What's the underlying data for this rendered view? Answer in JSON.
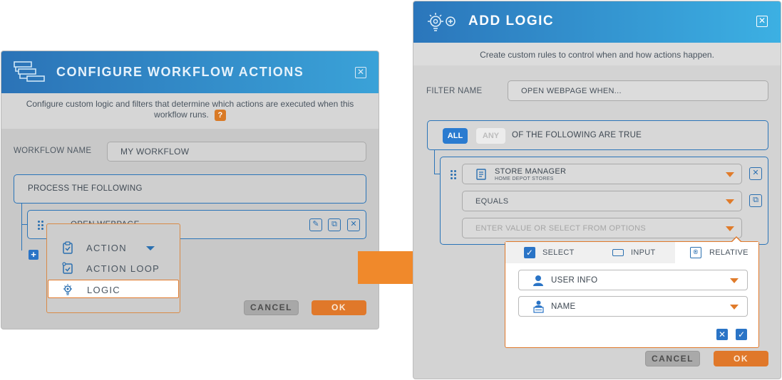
{
  "left_dialog": {
    "title": "CONFIGURE WORKFLOW ACTIONS",
    "description": "Configure custom logic and filters that determine which actions are executed when this workflow runs.",
    "help_badge": "?",
    "workflow_name_label": "WORKFLOW NAME",
    "workflow_name_value": "MY WORKFLOW",
    "process_label": "PROCESS THE FOLLOWING",
    "action_item_label": "OPEN WEBPAGE",
    "menu": {
      "items": [
        {
          "label": "ACTION",
          "icon": "clipboard-check-icon"
        },
        {
          "label": "ACTION LOOP",
          "icon": "loop-icon"
        },
        {
          "label": "LOGIC",
          "icon": "logic-bulb-icon"
        }
      ]
    },
    "cancel_label": "CANCEL",
    "ok_label": "OK"
  },
  "right_dialog": {
    "title": "ADD LOGIC",
    "description": "Create custom rules to control when and how actions happen.",
    "filter_name_label": "FILTER NAME",
    "filter_name_value": "OPEN WEBPAGE WHEN...",
    "all_label": "ALL",
    "any_label": "ANY",
    "condition_text": "OF THE FOLLOWING ARE TRUE",
    "field_select": {
      "label": "STORE MANAGER",
      "sublabel": "HOME DEPOT STORES"
    },
    "operator_select": "EQUALS",
    "value_placeholder": "ENTER VALUE OR SELECT FROM OPTIONS",
    "panel": {
      "tabs": [
        {
          "label": "SELECT"
        },
        {
          "label": "INPUT"
        },
        {
          "label": "RELATIVE"
        }
      ],
      "user_info_label": "USER INFO",
      "name_label": "NAME"
    },
    "cancel_label": "CANCEL",
    "ok_label": "OK"
  },
  "colors": {
    "header_blue": "#2b73b7",
    "accent_orange": "#e0782a",
    "arrow_orange": "#f0892b"
  }
}
